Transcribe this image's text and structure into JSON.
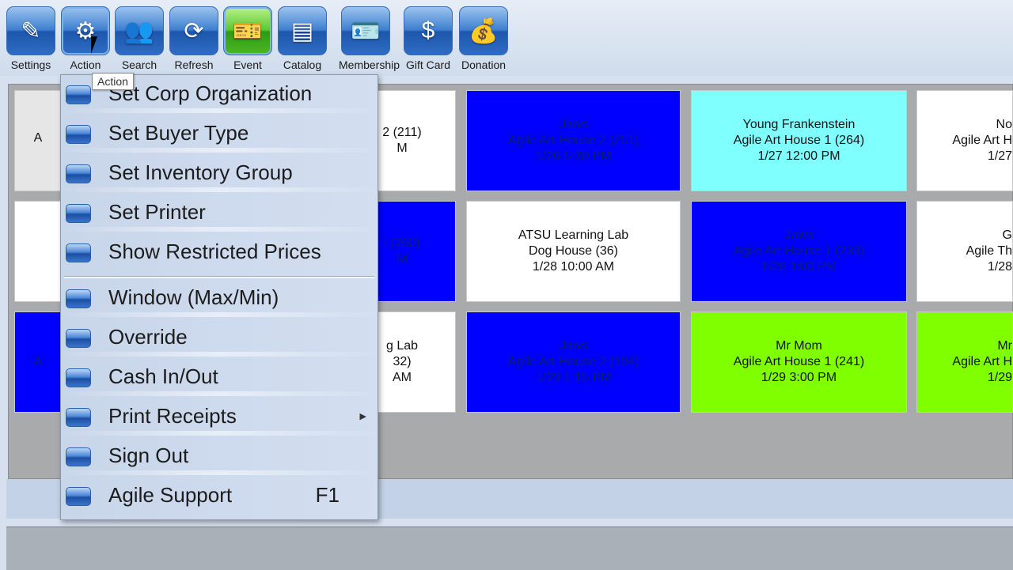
{
  "toolbar": {
    "buttons": [
      {
        "label": "Settings",
        "icon": "settings-icon",
        "glyph": "✎"
      },
      {
        "label": "Action",
        "icon": "gears-icon",
        "glyph": "⚙"
      },
      {
        "label": "Search",
        "icon": "people-search-icon",
        "glyph": "👥"
      },
      {
        "label": "Refresh",
        "icon": "refresh-icon",
        "glyph": "⟳"
      },
      {
        "label": "Event",
        "icon": "ticket-icon",
        "glyph": "🎫"
      },
      {
        "label": "Catalog",
        "icon": "catalog-icon",
        "glyph": "▤"
      },
      {
        "label": "Membership",
        "icon": "membership-card-icon",
        "glyph": "🪪"
      },
      {
        "label": "Gift Card",
        "icon": "gift-card-icon",
        "glyph": "$"
      },
      {
        "label": "Donation",
        "icon": "money-bag-icon",
        "glyph": "💰"
      }
    ],
    "tooltip": "Action"
  },
  "menu": {
    "items": [
      {
        "label": "Set Corp Organization"
      },
      {
        "label": "Set Buyer Type"
      },
      {
        "label": "Set Inventory Group"
      },
      {
        "label": "Set Printer"
      },
      {
        "label": "Show Restricted Prices"
      },
      {
        "label": "Window (Max/Min)"
      },
      {
        "label": "Override"
      },
      {
        "label": "Cash In/Out"
      },
      {
        "label": "Print Receipts",
        "submenu": true
      },
      {
        "label": "Sign Out"
      },
      {
        "label": "Agile Support",
        "shortcut": "F1"
      }
    ]
  },
  "colors": {
    "blue_tile": "#0000ff",
    "cyan_tile": "#80ffff",
    "green_tile": "#80ff00",
    "white_tile": "#ffffff",
    "grey_tile": "#e6e6e6"
  },
  "tiles": [
    {
      "lines": [
        "A"
      ],
      "color": "grey"
    },
    {
      "lines": [
        "2 (211)",
        "M"
      ],
      "color": "white"
    },
    {
      "lines": [
        "Jaws",
        "Agile Art House 2 (251)",
        "1/26 5:30 PM"
      ],
      "color": "blue"
    },
    {
      "lines": [
        "Young Frankenstein",
        "Agile Art House 1 (264)",
        "1/27 12:00 PM"
      ],
      "color": "cyan"
    },
    {
      "lines": [
        "No",
        "Agile Art H",
        "1/27"
      ],
      "color": "white"
    },
    {
      "lines": [
        ""
      ],
      "color": "white"
    },
    {
      "lines": [
        "l (260)",
        "M"
      ],
      "color": "blue"
    },
    {
      "lines": [
        "ATSU Learning Lab",
        "Dog House (36)",
        "1/28 10:00 AM"
      ],
      "color": "white"
    },
    {
      "lines": [
        "Jaws",
        "Agile Art House 1 (239)",
        "1/28 1:00 PM"
      ],
      "color": "blue"
    },
    {
      "lines": [
        "G",
        "Agile Th",
        "1/28"
      ],
      "color": "white"
    },
    {
      "lines": [
        "A"
      ],
      "color": "blue"
    },
    {
      "lines": [
        "g Lab",
        "32)",
        "AM"
      ],
      "color": "white"
    },
    {
      "lines": [
        "Jaws",
        "Agile Art House 2 (194)",
        "1/29 1:15 PM"
      ],
      "color": "blue"
    },
    {
      "lines": [
        "Mr Mom",
        "Agile Art House 1 (241)",
        "1/29 3:00 PM"
      ],
      "color": "green"
    },
    {
      "lines": [
        "Mr",
        "Agile Art H",
        "1/29"
      ],
      "color": "green"
    }
  ]
}
